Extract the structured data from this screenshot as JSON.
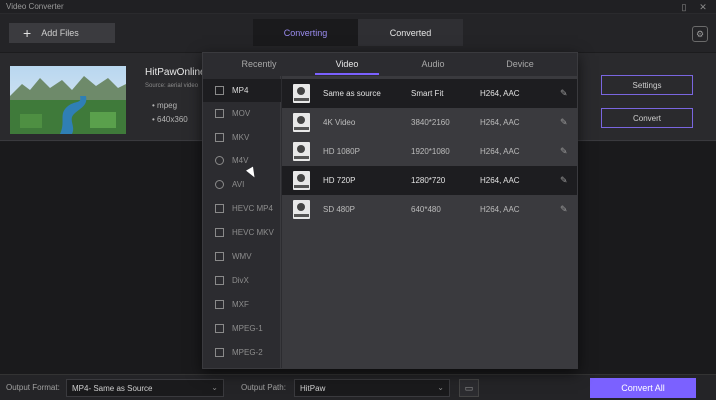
{
  "app": {
    "title": "Video Converter"
  },
  "toolbar": {
    "add_files_label": "Add Files",
    "tabs": [
      "Converting",
      "Converted"
    ]
  },
  "file": {
    "name": "HitPawOnline_",
    "source": "Source: aerial video",
    "format": "mpeg",
    "resolution": "640x360",
    "settings_label": "Settings",
    "convert_label": "Convert"
  },
  "panel": {
    "tabs": [
      "Recently",
      "Video",
      "Audio",
      "Device"
    ],
    "active_tab": "Video",
    "formats": [
      "MP4",
      "MOV",
      "MKV",
      "M4V",
      "AVI",
      "HEVC MP4",
      "HEVC MKV",
      "WMV",
      "DivX",
      "MXF",
      "MPEG-1",
      "MPEG-2"
    ],
    "active_format": "MP4",
    "presets": [
      {
        "name": "Same as source",
        "resolution": "Smart Fit",
        "codec": "H264, AAC"
      },
      {
        "name": "4K Video",
        "resolution": "3840*2160",
        "codec": "H264, AAC"
      },
      {
        "name": "HD 1080P",
        "resolution": "1920*1080",
        "codec": "H264, AAC"
      },
      {
        "name": "HD 720P",
        "resolution": "1280*720",
        "codec": "H264, AAC"
      },
      {
        "name": "SD 480P",
        "resolution": "640*480",
        "codec": "H264, AAC"
      }
    ]
  },
  "bottom": {
    "output_format_label": "Output Format:",
    "output_format_value": "MP4- Same as Source",
    "output_path_label": "Output Path:",
    "output_path_value": "HitPaw",
    "convert_all_label": "Convert All"
  },
  "colors": {
    "accent": "#7b61ff"
  }
}
